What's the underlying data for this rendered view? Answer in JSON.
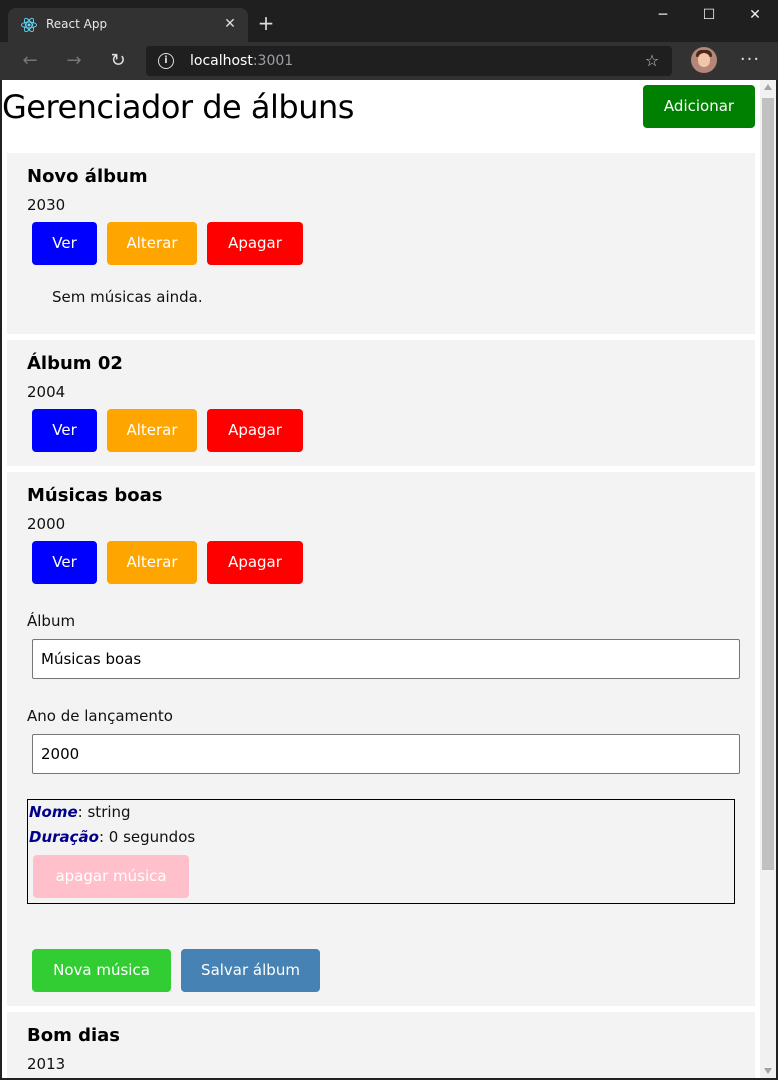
{
  "browser": {
    "tab_title": "React App",
    "url_host": "localhost",
    "url_port": ":3001",
    "tab_close_glyph": "✕",
    "new_tab_glyph": "+",
    "minimize_glyph": "─",
    "maximize_glyph": "☐",
    "close_glyph": "✕",
    "back_glyph": "←",
    "forward_glyph": "→",
    "reload_glyph": "↻",
    "info_glyph": "i",
    "favorites_glyph": "☆",
    "menu_glyph": "···"
  },
  "page": {
    "title": "Gerenciador de álbuns",
    "add_label": "Adicionar"
  },
  "albums": [
    {
      "title": "Novo álbum",
      "year": "2030",
      "view_label": "Ver",
      "edit_label": "Alterar",
      "delete_label": "Apagar",
      "empty_message": "Sem músicas ainda."
    },
    {
      "title": "Álbum 02",
      "year": "2004",
      "view_label": "Ver",
      "edit_label": "Alterar",
      "delete_label": "Apagar"
    },
    {
      "title": "Músicas boas",
      "year": "2000",
      "view_label": "Ver",
      "edit_label": "Alterar",
      "delete_label": "Apagar",
      "form": {
        "album_label": "Álbum",
        "album_value": "Músicas boas",
        "year_label": "Ano de lançamento",
        "year_value": "2000",
        "songs": [
          {
            "name_key": "Nome",
            "name_value": ": string",
            "duration_key": "Duração",
            "duration_value": ": 0 segundos",
            "delete_label": "apagar música"
          }
        ],
        "new_song_label": "Nova música",
        "save_label": "Salvar álbum"
      }
    },
    {
      "title": "Bom dias",
      "year": "2013"
    }
  ],
  "colors": {
    "add": "#008000",
    "view": "#0000ff",
    "edit": "#ffa500",
    "delete": "#ff0000",
    "delete_song": "#ffc0cb",
    "new_song": "#32cd32",
    "save": "#4682b4",
    "card_bg": "#f3f3f3"
  }
}
